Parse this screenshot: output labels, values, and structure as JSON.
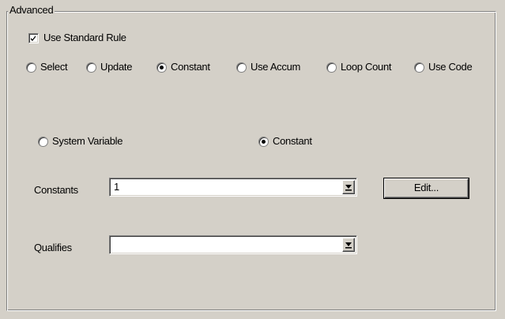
{
  "group": {
    "title": "Advanced"
  },
  "use_standard_rule": {
    "label": "Use Standard Rule",
    "checked": true
  },
  "mode_radios": [
    {
      "label": "Select",
      "selected": false
    },
    {
      "label": "Update",
      "selected": false
    },
    {
      "label": "Constant",
      "selected": true
    },
    {
      "label": "Use Accum",
      "selected": false
    },
    {
      "label": "Loop Count",
      "selected": false
    },
    {
      "label": "Use Code",
      "selected": false
    }
  ],
  "source_radios": [
    {
      "label": "System Variable",
      "selected": false
    },
    {
      "label": "Constant",
      "selected": true
    }
  ],
  "constants": {
    "label": "Constants",
    "value": "1"
  },
  "edit_button": {
    "label": "Edit..."
  },
  "qualifies": {
    "label": "Qualifies",
    "value": ""
  },
  "icons": {
    "checkmark": "checkmark-icon",
    "dropdown": "dropdown-arrow-icon"
  },
  "colors": {
    "face": "#d4d0c8",
    "field": "#ffffff",
    "shadow": "#808080"
  }
}
